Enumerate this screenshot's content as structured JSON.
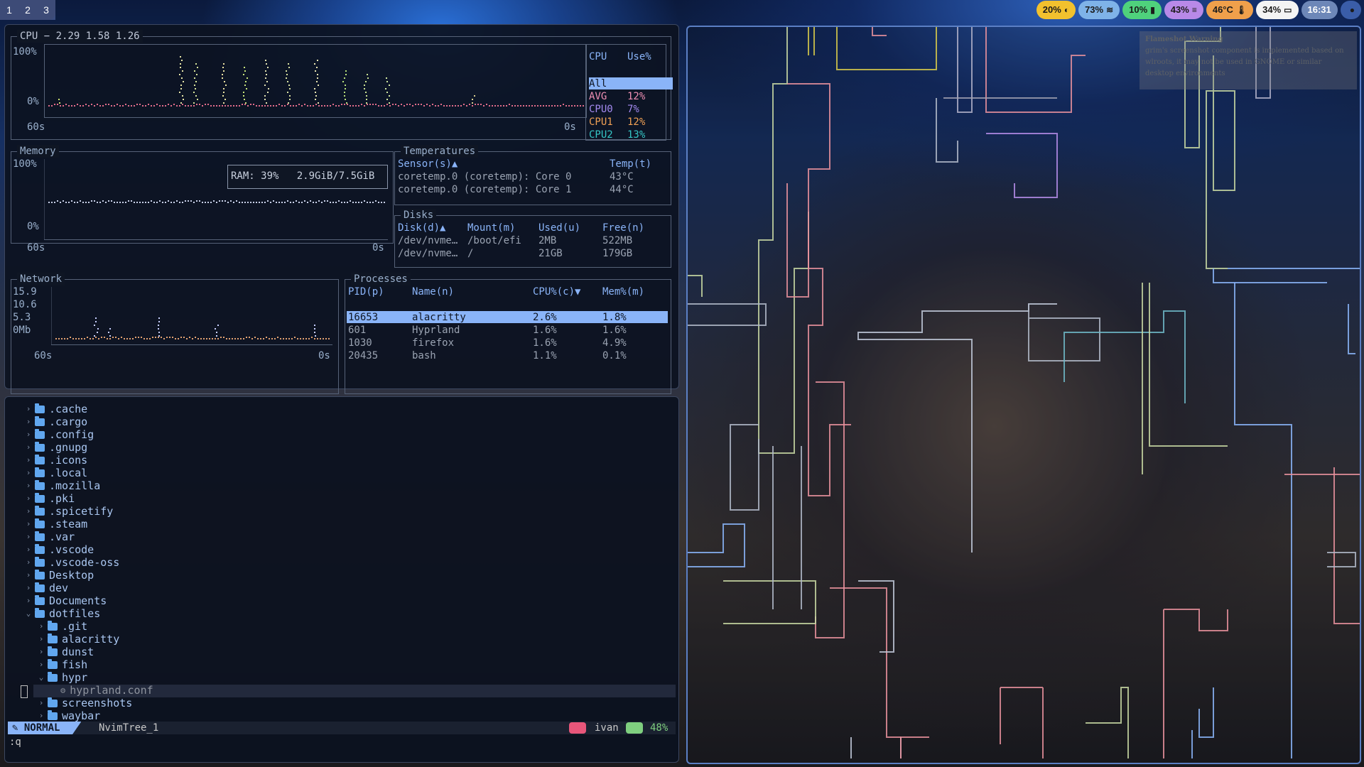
{
  "workspaces": [
    "1",
    "2",
    "3"
  ],
  "topbar": [
    {
      "text": "20%",
      "icon": "headphones-icon",
      "glyph": "◐",
      "color": "#f2c12e"
    },
    {
      "text": "73%",
      "icon": "wifi-icon",
      "glyph": "≋",
      "color": "#7fb3e8"
    },
    {
      "text": "10%",
      "icon": "battery-icon",
      "glyph": "▮",
      "color": "#4fd17c"
    },
    {
      "text": "43%",
      "icon": "memory-icon",
      "glyph": "≡",
      "color": "#b889e8"
    },
    {
      "text": "46°C",
      "icon": "thermometer-icon",
      "glyph": "🌡",
      "color": "#f0a04b"
    },
    {
      "text": "34%",
      "icon": "brightness-icon",
      "glyph": "▭",
      "color": "#f4f4f4"
    },
    {
      "text": "16:31",
      "icon": "",
      "glyph": "",
      "color": "#6d87b8"
    },
    {
      "text": "",
      "icon": "power-icon",
      "glyph": "●",
      "color": "#3a5da8"
    }
  ],
  "cpu": {
    "title": "CPU − 2.29 1.58 1.26",
    "y_top": "100%",
    "y_bottom": "0%",
    "x_left": "60s",
    "x_right": "0s",
    "list_header_cpu": "CPU",
    "list_header_use": "Use%",
    "all": "All",
    "cores": [
      {
        "name": "AVG",
        "use": "12%",
        "color": "#ef8fb3"
      },
      {
        "name": "CPU0",
        "use": "7%",
        "color": "#a48af0"
      },
      {
        "name": "CPU1",
        "use": "12%",
        "color": "#f0a055"
      },
      {
        "name": "CPU2",
        "use": "13%",
        "color": "#35c6c6"
      }
    ]
  },
  "memory": {
    "title": "Memory",
    "y_top": "100%",
    "y_bottom": "0%",
    "x_left": "60s",
    "x_right": "0s",
    "ram": "RAM: 39%   2.9GiB/7.5GiB"
  },
  "temps": {
    "title": "Temperatures",
    "h_sensor": "Sensor(s)▲",
    "h_temp": "Temp(t)",
    "rows": [
      {
        "sensor": "coretemp.0 (coretemp): Core 0",
        "temp": "43°C"
      },
      {
        "sensor": "coretemp.0 (coretemp): Core 1",
        "temp": "44°C"
      }
    ]
  },
  "disks": {
    "title": "Disks",
    "h_disk": "Disk(d)▲",
    "h_mount": "Mount(m)",
    "h_used": "Used(u)",
    "h_free": "Free(n)",
    "rows": [
      {
        "disk": "/dev/nvme…",
        "mount": "/boot/efi",
        "used": "2MB",
        "free": "522MB"
      },
      {
        "disk": "/dev/nvme…",
        "mount": "/",
        "used": "21GB",
        "free": "179GB"
      }
    ]
  },
  "network": {
    "title": "Network",
    "y": [
      "15.9",
      "10.6",
      "5.3",
      "0Mb"
    ],
    "x_left": "60s",
    "x_right": "0s"
  },
  "processes": {
    "title": "Processes",
    "h_pid": "PID(p)",
    "h_name": "Name(n)",
    "h_cpu": "CPU%(c)▼",
    "h_mem": "Mem%(m)",
    "rows": [
      {
        "pid": "16653",
        "name": "alacritty",
        "cpu": "2.6%",
        "mem": "1.8%"
      },
      {
        "pid": "601",
        "name": "Hyprland",
        "cpu": "1.6%",
        "mem": "1.6%"
      },
      {
        "pid": "1030",
        "name": "firefox",
        "cpu": "1.6%",
        "mem": "4.9%"
      },
      {
        "pid": "20435",
        "name": "bash",
        "cpu": "1.1%",
        "mem": "0.1%"
      }
    ]
  },
  "tree": [
    {
      "name": ".cache",
      "depth": 0,
      "open": false
    },
    {
      "name": ".cargo",
      "depth": 0,
      "open": false
    },
    {
      "name": ".config",
      "depth": 0,
      "open": false
    },
    {
      "name": ".gnupg",
      "depth": 0,
      "open": false
    },
    {
      "name": ".icons",
      "depth": 0,
      "open": false
    },
    {
      "name": ".local",
      "depth": 0,
      "open": false
    },
    {
      "name": ".mozilla",
      "depth": 0,
      "open": false
    },
    {
      "name": ".pki",
      "depth": 0,
      "open": false
    },
    {
      "name": ".spicetify",
      "depth": 0,
      "open": false
    },
    {
      "name": ".steam",
      "depth": 0,
      "open": false
    },
    {
      "name": ".var",
      "depth": 0,
      "open": false
    },
    {
      "name": ".vscode",
      "depth": 0,
      "open": false
    },
    {
      "name": ".vscode-oss",
      "depth": 0,
      "open": false
    },
    {
      "name": "Desktop",
      "depth": 0,
      "open": false
    },
    {
      "name": "dev",
      "depth": 0,
      "open": false
    },
    {
      "name": "Documents",
      "depth": 0,
      "open": false
    },
    {
      "name": "dotfiles",
      "depth": 0,
      "open": true
    },
    {
      "name": ".git",
      "depth": 1,
      "open": false
    },
    {
      "name": "alacritty",
      "depth": 1,
      "open": false
    },
    {
      "name": "dunst",
      "depth": 1,
      "open": false
    },
    {
      "name": "fish",
      "depth": 1,
      "open": false
    },
    {
      "name": "hypr",
      "depth": 1,
      "open": true
    },
    {
      "name": "hyprland.conf",
      "depth": 2,
      "file": true
    },
    {
      "name": "screenshots",
      "depth": 1,
      "open": false
    },
    {
      "name": "waybar",
      "depth": 1,
      "open": false
    }
  ],
  "statusline": {
    "mode": "NORMAL",
    "buffer": "NvimTree_1",
    "user": "ivan",
    "percent": "48%",
    "cmd": ":q"
  },
  "warning": {
    "title": "Flameshot Warning",
    "body": "grim's screenshot component is implemented based on wlroots, it may not be used in GNOME or similar desktop environments"
  }
}
